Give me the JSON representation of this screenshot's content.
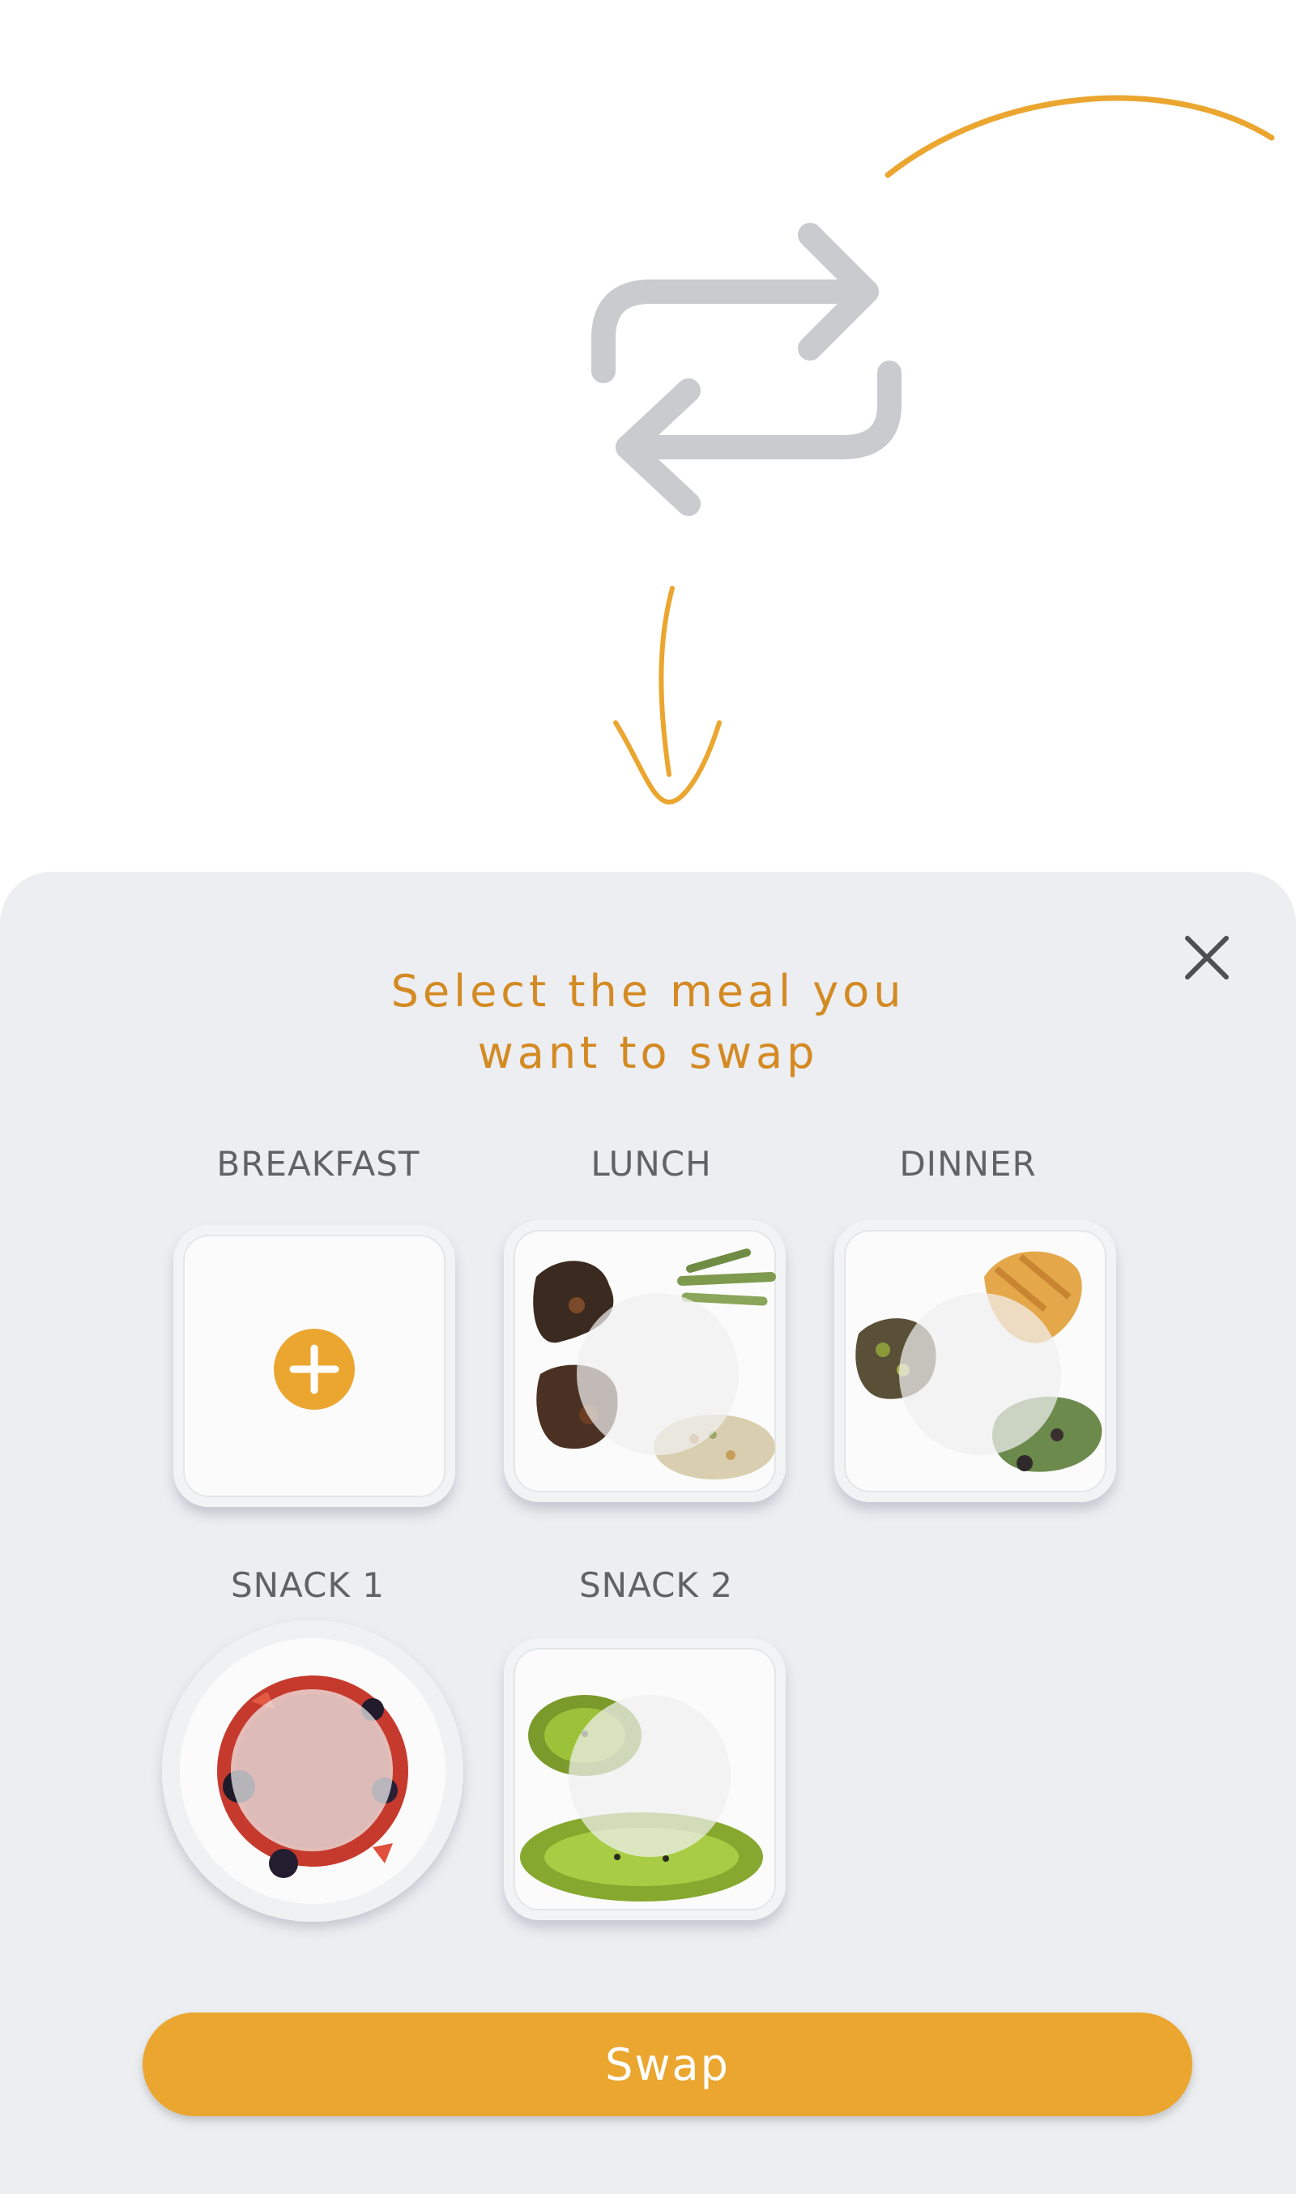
{
  "header": {
    "title_line1": "Select the meal you",
    "title_line2": "want to swap"
  },
  "icons": {
    "swap": "swap-arrows-icon",
    "close": "close-icon",
    "add": "plus-circle-icon"
  },
  "meals": [
    {
      "label": "BREAKFAST",
      "state": "empty"
    },
    {
      "label": "LUNCH",
      "state": "filled"
    },
    {
      "label": "DINNER",
      "state": "filled"
    },
    {
      "label": "SNACK 1",
      "state": "filled"
    },
    {
      "label": "SNACK 2",
      "state": "filled"
    }
  ],
  "actions": {
    "swap_label": "Swap"
  },
  "colors": {
    "accent": "#eba630",
    "title": "#d48a23",
    "arrow_gray": "#c9cbcf",
    "sheet_bg": "#eceef1"
  }
}
